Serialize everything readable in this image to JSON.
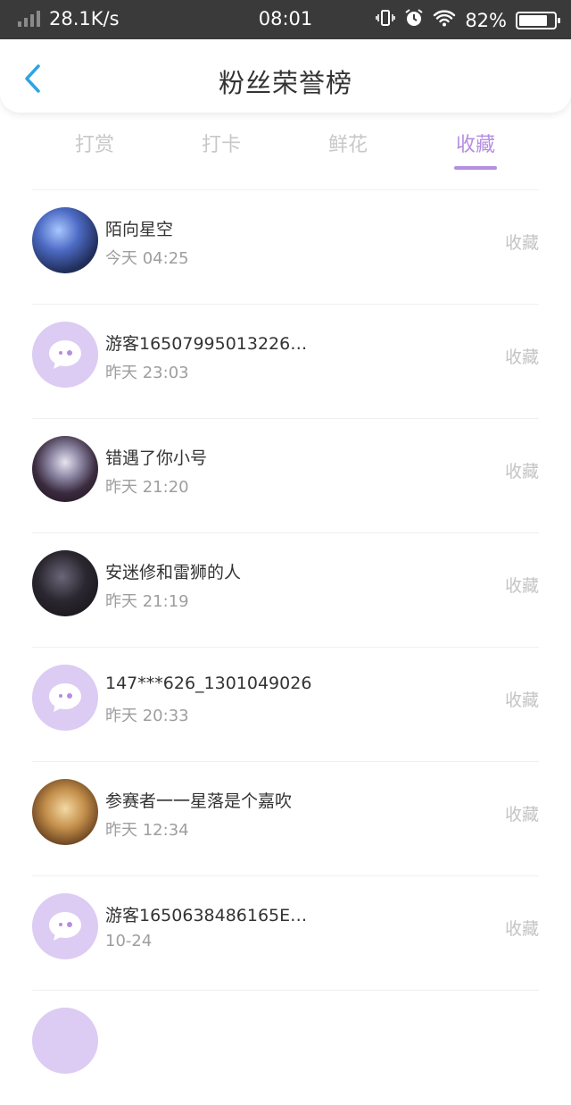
{
  "status_bar": {
    "speed": "28.1K/s",
    "time": "08:01",
    "battery": "82%",
    "battery_level": 0.82,
    "icons": [
      "signal-icon",
      "vibrate-icon",
      "alarm-icon",
      "wifi-icon",
      "battery-icon"
    ]
  },
  "header": {
    "title": "粉丝荣誉榜",
    "back_icon": "chevron-left-icon"
  },
  "tabs": [
    {
      "label": "打赏",
      "active": false
    },
    {
      "label": "打卡",
      "active": false
    },
    {
      "label": "鲜花",
      "active": false
    },
    {
      "label": "收藏",
      "active": true
    }
  ],
  "colors": {
    "accent": "#b58ee0",
    "default_avatar": "#dccbf3",
    "status_bar": "#3a3a3a"
  },
  "rows": [
    {
      "name": "陌向星空",
      "time": "今天 04:25",
      "action": "收藏",
      "avatar": "photo"
    },
    {
      "name": "游客16507995013226…",
      "time": "昨天 23:03",
      "action": "收藏",
      "avatar": "default"
    },
    {
      "name": "错遇了你小号",
      "time": "昨天 21:20",
      "action": "收藏",
      "avatar": "photo"
    },
    {
      "name": "安迷修和雷狮的人",
      "time": "昨天 21:19",
      "action": "收藏",
      "avatar": "photo"
    },
    {
      "name": "147***626_1301049026",
      "time": "昨天 20:33",
      "action": "收藏",
      "avatar": "default"
    },
    {
      "name": "参赛者一一星落是个嘉吹",
      "time": "昨天 12:34",
      "action": "收藏",
      "avatar": "photo"
    },
    {
      "name": "游客1650638486165E…",
      "time": "10-24",
      "action": "收藏",
      "avatar": "default"
    }
  ]
}
